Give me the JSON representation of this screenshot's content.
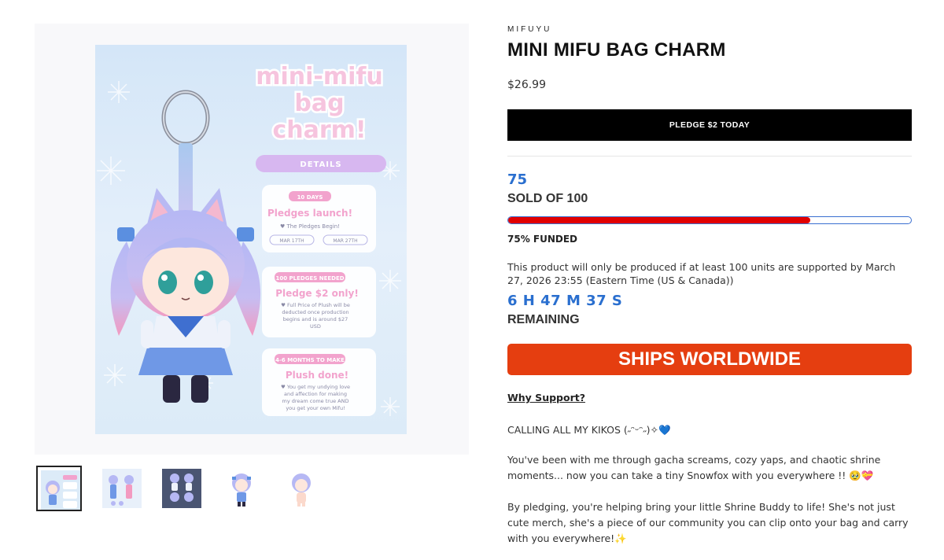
{
  "product": {
    "vendor": "MIFUYU",
    "title": "MINI MIFU BAG CHARM",
    "price": "$26.99",
    "pledge_button": "PLEDGE $2 TODAY"
  },
  "campaign": {
    "sold_count": "75",
    "sold_label": "SOLD OF 100",
    "progress_fraction": 0.75,
    "funded_label": "75% FUNDED",
    "notice": "This product will only be produced if at least 100 units are supported by March 27, 2026 23:55 (Eastern Time (US & Canada))",
    "countdown": "6 H 47 M 37 S",
    "remaining_label": "REMAINING",
    "ships_banner": "SHIPS WORLDWIDE"
  },
  "description": {
    "why_link": "Why Support?",
    "paragraphs": [
      "CALLING ALL MY KIKOS (˶ᵔᵕᵔ˶)✧💙",
      "You've been with me through gacha screams, cozy yaps, and chaotic shrine moments... now you can take a tiny Snowfox with you everywhere !! 🥹💝",
      "By pledging, you're helping bring your little Shrine Buddy to life! She's not just cute merch, she's a piece of our community you can clip onto your bag and carry with you everywhere!✨"
    ]
  },
  "poster": {
    "title_lines": [
      "mini-mifu",
      "bag",
      "charm!"
    ],
    "details_label": "DETAILS",
    "card1": {
      "badge": "10 DAYS",
      "heading": "Pledges launch!",
      "sub": "♥ The Pledges Begin!",
      "date_start": "MAR 17TH",
      "date_end": "MAR 27TH"
    },
    "card2": {
      "badge": "100 PLEDGES NEEDED",
      "heading": "Pledge $2 only!",
      "body": [
        "♥ Full Price of Plush will be",
        "deducted once production",
        "begins and is around $27",
        "USD"
      ]
    },
    "card3": {
      "badge": "4-6 MONTHS TO MAKE",
      "heading": "Plush done!",
      "body": [
        "♥ You get my undying love",
        "and affection for making",
        "my dream come true AND",
        "you get your own Mifu!"
      ]
    }
  },
  "colors": {
    "accent_blue": "#2a6fcf",
    "progress_red": "#e10000",
    "ships_orange": "#e53e10",
    "poster_pink": "#f2a3cd",
    "poster_sky": "#dcebf8"
  },
  "thumbnails": [
    {
      "name": "poster",
      "selected": true
    },
    {
      "name": "turnaround",
      "selected": false
    },
    {
      "name": "sheet",
      "selected": false
    },
    {
      "name": "front",
      "selected": false
    },
    {
      "name": "base",
      "selected": false
    }
  ]
}
